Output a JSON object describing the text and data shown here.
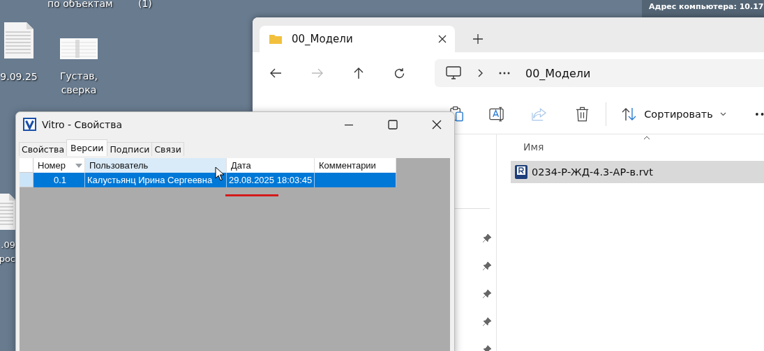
{
  "desktop": {
    "top_labels": [
      "по объектам",
      "(1)"
    ],
    "icons": [
      {
        "kind": "document",
        "label": "9.09.25"
      },
      {
        "kind": "spreadsheet",
        "label": "Густав, сверка"
      },
      {
        "kind": "document",
        "label": ".09 рос"
      }
    ],
    "info_panel": {
      "text": "Адрес компьютера: 10.17"
    }
  },
  "explorer": {
    "tabs": [
      {
        "label": "00_Модели",
        "selected": true
      }
    ],
    "breadcrumb": "00_Модели",
    "sort_label": "Сортировать",
    "column": "Имя",
    "files": [
      {
        "name": "0234-Р-ЖД-4.3-АР-в.rvt",
        "selected": true
      }
    ]
  },
  "dialog": {
    "title": "Vitro - Свойства",
    "tabs": [
      {
        "label": "Свойства",
        "selected": false
      },
      {
        "label": "Версии",
        "selected": true
      },
      {
        "label": "Подписи",
        "selected": false
      },
      {
        "label": "Связи",
        "selected": false
      }
    ],
    "columns": [
      {
        "label": "Номер",
        "sorted": true,
        "hovered": false
      },
      {
        "label": "Пользователь",
        "sorted": false,
        "hovered": true
      },
      {
        "label": "Дата",
        "sorted": false,
        "hovered": false
      },
      {
        "label": "Комментарии",
        "sorted": false,
        "hovered": false
      }
    ],
    "rows": [
      {
        "cells": [
          "0.1",
          "Калустьянц Ирина Сергеевна",
          "29.08.2025 18:03:45",
          ""
        ],
        "selected": true
      }
    ]
  }
}
